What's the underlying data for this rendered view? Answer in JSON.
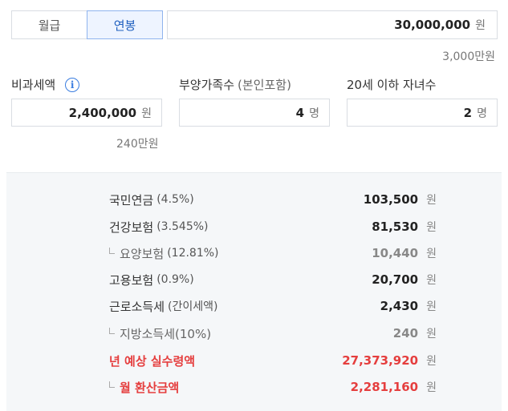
{
  "mode_toggle": {
    "monthly_label": "월급",
    "annual_label": "연봉",
    "selected": "annual"
  },
  "salary": {
    "value": "30,000,000",
    "unit": "원",
    "hint": "3,000만원"
  },
  "nontax": {
    "label": "비과세액",
    "value": "2,400,000",
    "unit": "원",
    "hint": "240만원",
    "info_icon": "info-icon"
  },
  "dependents": {
    "label": "부양가족수",
    "label_paren": "(본인포함)",
    "value": "4",
    "unit": "명"
  },
  "children": {
    "label": "20세 이하 자녀수",
    "value": "2",
    "unit": "명"
  },
  "results": {
    "pension": {
      "name": "국민연금",
      "rate": "(4.5%)",
      "amount": "103,500",
      "unit": "원"
    },
    "health": {
      "name": "건강보험",
      "rate": "(3.545%)",
      "amount": "81,530",
      "unit": "원"
    },
    "longterm": {
      "name": "요양보험",
      "rate": "(12.81%)",
      "amount": "10,440",
      "unit": "원"
    },
    "employment": {
      "name": "고용보험",
      "rate": "(0.9%)",
      "amount": "20,700",
      "unit": "원"
    },
    "income_tax": {
      "name": "근로소득세",
      "rate": "(간이세액)",
      "amount": "2,430",
      "unit": "원"
    },
    "local_tax": {
      "name": "지방소득세(10%)",
      "amount": "240",
      "unit": "원"
    },
    "annual_net": {
      "name": "년 예상 실수령액",
      "amount": "27,373,920",
      "unit": "원"
    },
    "monthly_net": {
      "name": "월 환산금액",
      "amount": "2,281,160",
      "unit": "원"
    }
  },
  "colors": {
    "accent": "#3a7de0",
    "highlight": "#e53e3e",
    "result_bg": "#f5f7f9"
  }
}
